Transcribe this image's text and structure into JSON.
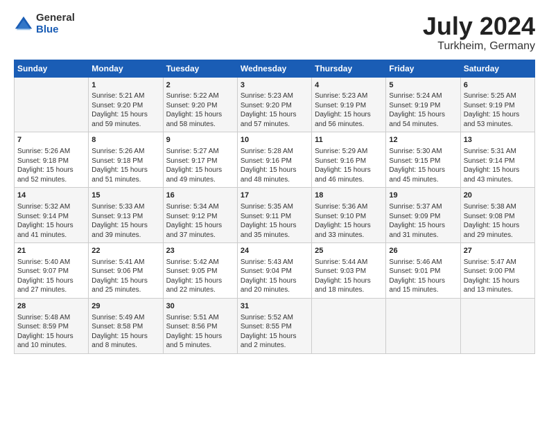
{
  "logo": {
    "general": "General",
    "blue": "Blue"
  },
  "title": "July 2024",
  "subtitle": "Turkheim, Germany",
  "headers": [
    "Sunday",
    "Monday",
    "Tuesday",
    "Wednesday",
    "Thursday",
    "Friday",
    "Saturday"
  ],
  "weeks": [
    [
      {
        "day": "",
        "info": ""
      },
      {
        "day": "1",
        "info": "Sunrise: 5:21 AM\nSunset: 9:20 PM\nDaylight: 15 hours\nand 59 minutes."
      },
      {
        "day": "2",
        "info": "Sunrise: 5:22 AM\nSunset: 9:20 PM\nDaylight: 15 hours\nand 58 minutes."
      },
      {
        "day": "3",
        "info": "Sunrise: 5:23 AM\nSunset: 9:20 PM\nDaylight: 15 hours\nand 57 minutes."
      },
      {
        "day": "4",
        "info": "Sunrise: 5:23 AM\nSunset: 9:19 PM\nDaylight: 15 hours\nand 56 minutes."
      },
      {
        "day": "5",
        "info": "Sunrise: 5:24 AM\nSunset: 9:19 PM\nDaylight: 15 hours\nand 54 minutes."
      },
      {
        "day": "6",
        "info": "Sunrise: 5:25 AM\nSunset: 9:19 PM\nDaylight: 15 hours\nand 53 minutes."
      }
    ],
    [
      {
        "day": "7",
        "info": "Sunrise: 5:26 AM\nSunset: 9:18 PM\nDaylight: 15 hours\nand 52 minutes."
      },
      {
        "day": "8",
        "info": "Sunrise: 5:26 AM\nSunset: 9:18 PM\nDaylight: 15 hours\nand 51 minutes."
      },
      {
        "day": "9",
        "info": "Sunrise: 5:27 AM\nSunset: 9:17 PM\nDaylight: 15 hours\nand 49 minutes."
      },
      {
        "day": "10",
        "info": "Sunrise: 5:28 AM\nSunset: 9:16 PM\nDaylight: 15 hours\nand 48 minutes."
      },
      {
        "day": "11",
        "info": "Sunrise: 5:29 AM\nSunset: 9:16 PM\nDaylight: 15 hours\nand 46 minutes."
      },
      {
        "day": "12",
        "info": "Sunrise: 5:30 AM\nSunset: 9:15 PM\nDaylight: 15 hours\nand 45 minutes."
      },
      {
        "day": "13",
        "info": "Sunrise: 5:31 AM\nSunset: 9:14 PM\nDaylight: 15 hours\nand 43 minutes."
      }
    ],
    [
      {
        "day": "14",
        "info": "Sunrise: 5:32 AM\nSunset: 9:14 PM\nDaylight: 15 hours\nand 41 minutes."
      },
      {
        "day": "15",
        "info": "Sunrise: 5:33 AM\nSunset: 9:13 PM\nDaylight: 15 hours\nand 39 minutes."
      },
      {
        "day": "16",
        "info": "Sunrise: 5:34 AM\nSunset: 9:12 PM\nDaylight: 15 hours\nand 37 minutes."
      },
      {
        "day": "17",
        "info": "Sunrise: 5:35 AM\nSunset: 9:11 PM\nDaylight: 15 hours\nand 35 minutes."
      },
      {
        "day": "18",
        "info": "Sunrise: 5:36 AM\nSunset: 9:10 PM\nDaylight: 15 hours\nand 33 minutes."
      },
      {
        "day": "19",
        "info": "Sunrise: 5:37 AM\nSunset: 9:09 PM\nDaylight: 15 hours\nand 31 minutes."
      },
      {
        "day": "20",
        "info": "Sunrise: 5:38 AM\nSunset: 9:08 PM\nDaylight: 15 hours\nand 29 minutes."
      }
    ],
    [
      {
        "day": "21",
        "info": "Sunrise: 5:40 AM\nSunset: 9:07 PM\nDaylight: 15 hours\nand 27 minutes."
      },
      {
        "day": "22",
        "info": "Sunrise: 5:41 AM\nSunset: 9:06 PM\nDaylight: 15 hours\nand 25 minutes."
      },
      {
        "day": "23",
        "info": "Sunrise: 5:42 AM\nSunset: 9:05 PM\nDaylight: 15 hours\nand 22 minutes."
      },
      {
        "day": "24",
        "info": "Sunrise: 5:43 AM\nSunset: 9:04 PM\nDaylight: 15 hours\nand 20 minutes."
      },
      {
        "day": "25",
        "info": "Sunrise: 5:44 AM\nSunset: 9:03 PM\nDaylight: 15 hours\nand 18 minutes."
      },
      {
        "day": "26",
        "info": "Sunrise: 5:46 AM\nSunset: 9:01 PM\nDaylight: 15 hours\nand 15 minutes."
      },
      {
        "day": "27",
        "info": "Sunrise: 5:47 AM\nSunset: 9:00 PM\nDaylight: 15 hours\nand 13 minutes."
      }
    ],
    [
      {
        "day": "28",
        "info": "Sunrise: 5:48 AM\nSunset: 8:59 PM\nDaylight: 15 hours\nand 10 minutes."
      },
      {
        "day": "29",
        "info": "Sunrise: 5:49 AM\nSunset: 8:58 PM\nDaylight: 15 hours\nand 8 minutes."
      },
      {
        "day": "30",
        "info": "Sunrise: 5:51 AM\nSunset: 8:56 PM\nDaylight: 15 hours\nand 5 minutes."
      },
      {
        "day": "31",
        "info": "Sunrise: 5:52 AM\nSunset: 8:55 PM\nDaylight: 15 hours\nand 2 minutes."
      },
      {
        "day": "",
        "info": ""
      },
      {
        "day": "",
        "info": ""
      },
      {
        "day": "",
        "info": ""
      }
    ]
  ]
}
